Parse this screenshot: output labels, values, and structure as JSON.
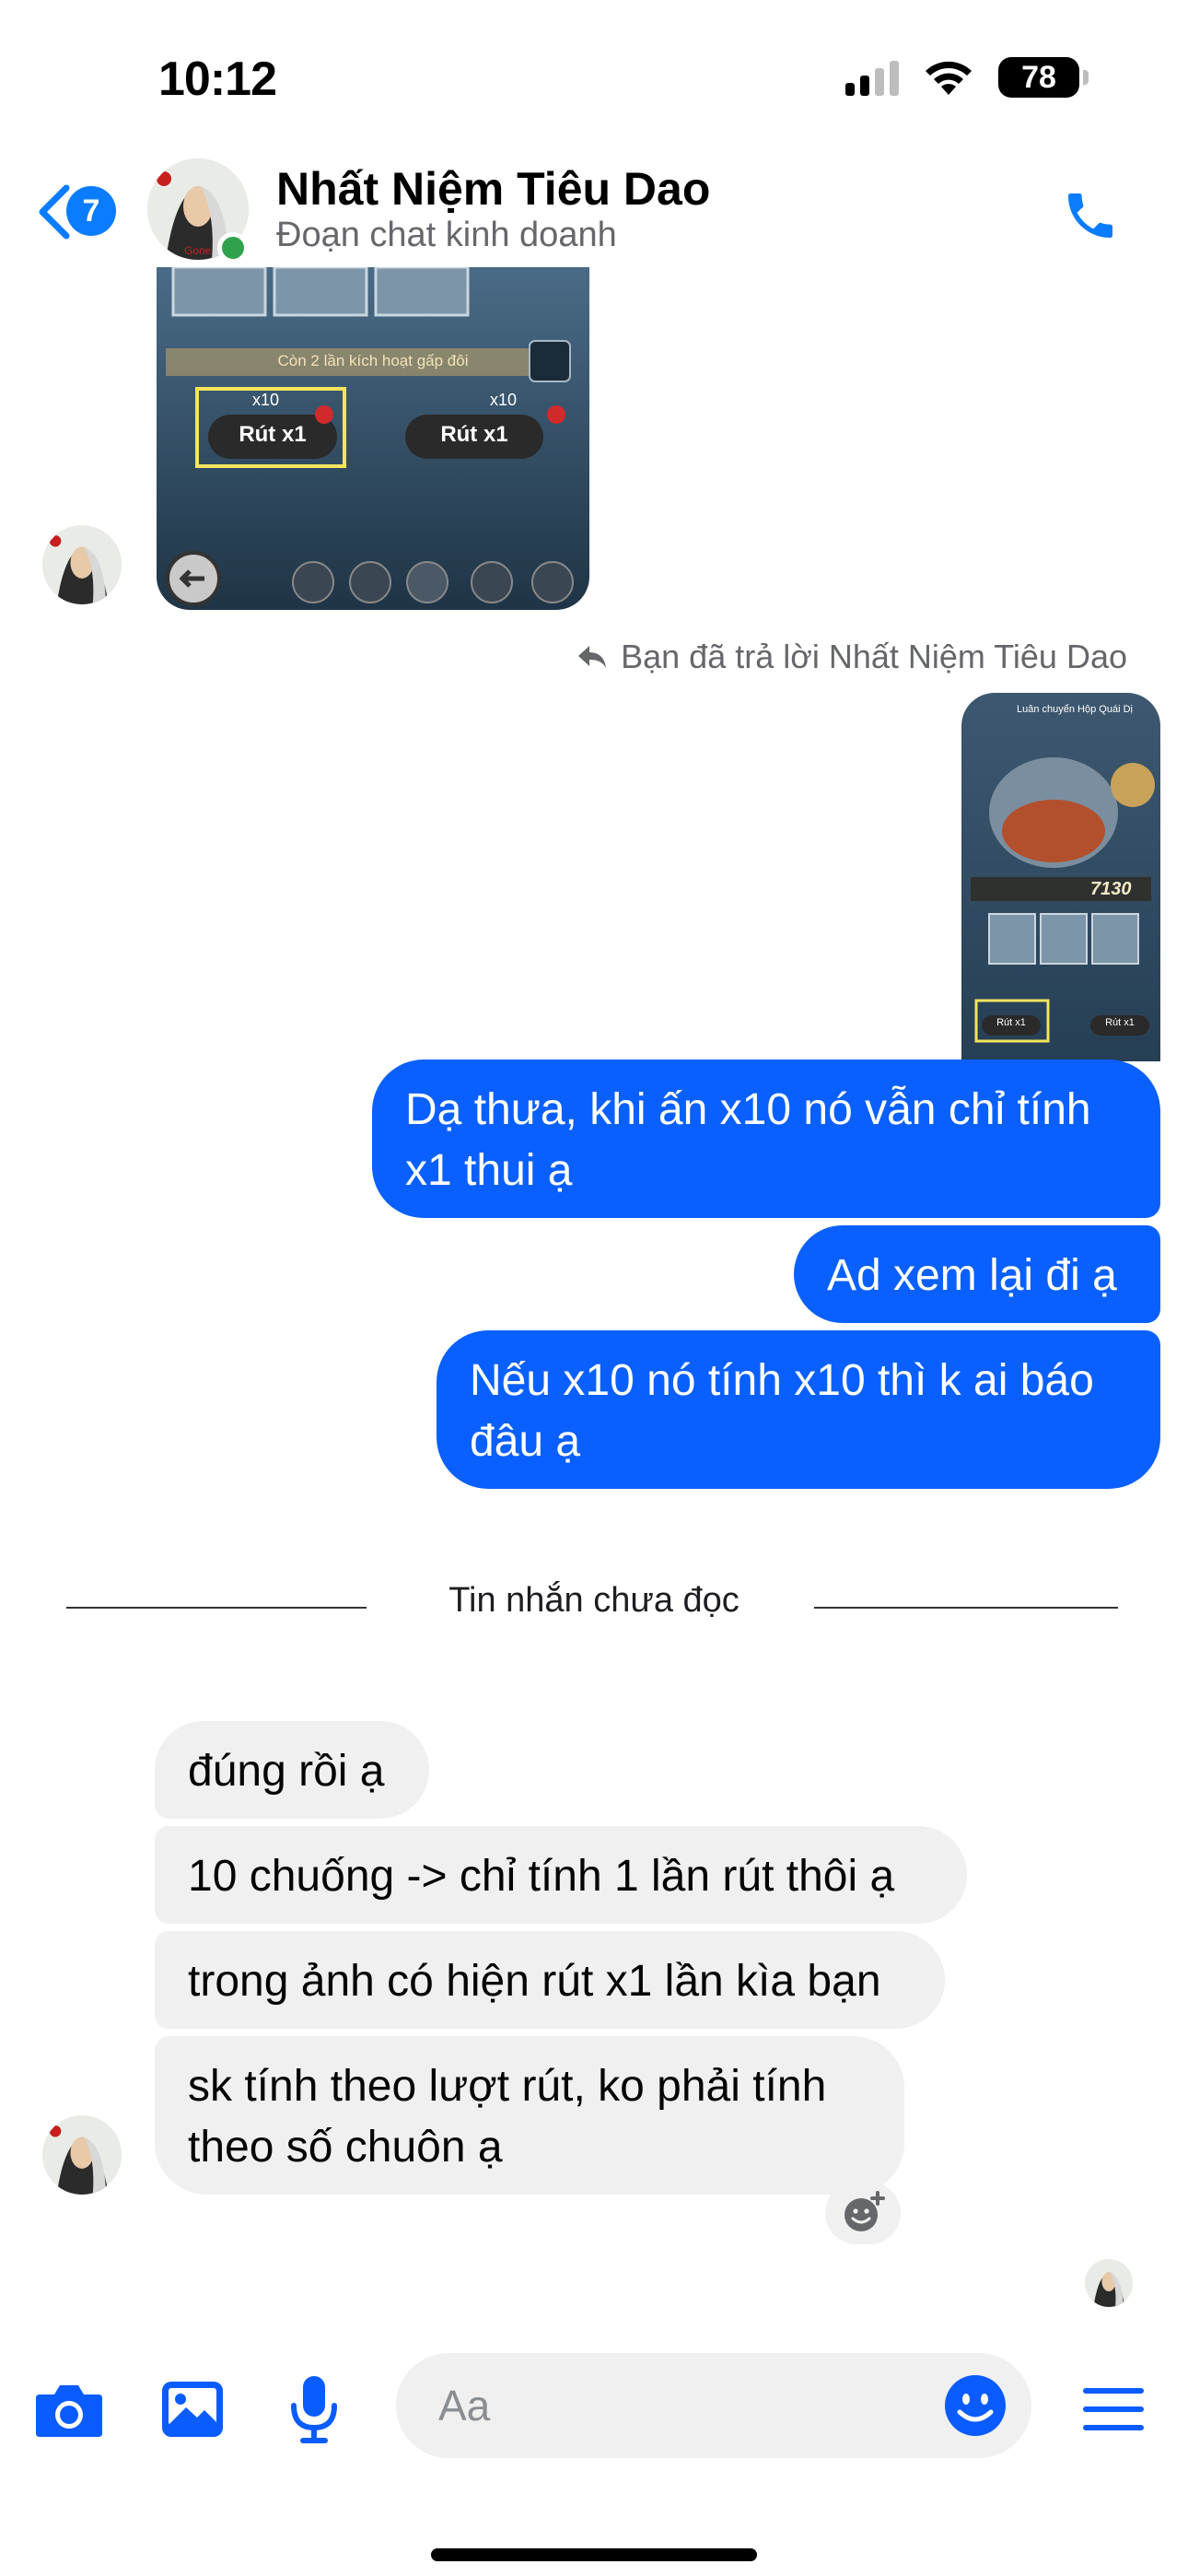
{
  "status_bar": {
    "time": "10:12",
    "battery": "78"
  },
  "header": {
    "unread_count": "7",
    "contact_name": "Nhất Niệm Tiêu Dao",
    "subtitle": "Đoạn chat kinh doanh"
  },
  "thread": {
    "first_image": {
      "banner": "Còn 2 lần kích hoạt gấp đôi",
      "left_multiplier": "x10",
      "right_multiplier": "x10",
      "left_button": "Rút x1",
      "right_button": "Rút x1"
    },
    "reply_note": "Bạn đã trả lời Nhất Niệm Tiêu Dao",
    "reply_image": {
      "title": "Luân chuyển Hộp Quái Dị",
      "count": "7130",
      "left_button": "Rút x1",
      "right_button": "Rút x1"
    },
    "outgoing": [
      {
        "lines": [
          "Dạ thưa, khi ấn x10 nó vẫn chỉ tính",
          "x1 thui ạ"
        ]
      },
      {
        "lines": [
          "Ad xem lại đi ạ"
        ]
      },
      {
        "lines": [
          "Nếu x10 nó tính x10 thì k ai báo",
          "đâu ạ"
        ]
      }
    ],
    "unread_divider": "Tin nhắn chưa đọc",
    "incoming": [
      {
        "lines": [
          "đúng rồi ạ"
        ]
      },
      {
        "lines": [
          "10 chuống -> chỉ tính 1 lần rút thôi ạ"
        ]
      },
      {
        "lines": [
          "trong ảnh có hiện rút x1 lần kìa bạn"
        ]
      },
      {
        "lines": [
          "sk tính theo lượt rút, ko phải tính",
          "theo số chuôn ạ"
        ]
      }
    ]
  },
  "composer": {
    "placeholder": "Aa"
  },
  "colors": {
    "accent": "#0a7cff",
    "outgoing_bubble": "#0a60ff",
    "incoming_bubble": "#f0f0f0",
    "online": "#31a24c"
  }
}
